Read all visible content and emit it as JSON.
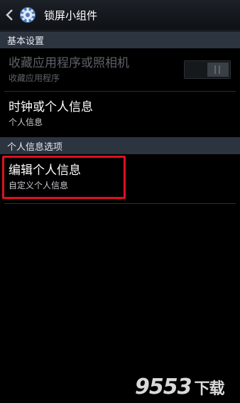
{
  "header": {
    "title": "锁屏小组件"
  },
  "sections": {
    "basic": "基本设置",
    "personal": "个人信息选项"
  },
  "items": {
    "favorite_apps": {
      "title": "收藏应用程序或照相机",
      "subtitle": "收藏应用程序",
      "enabled": false,
      "toggle_on": false
    },
    "clock_info": {
      "title": "时钟或个人信息",
      "subtitle": "个人信息"
    },
    "edit_info": {
      "title": "编辑个人信息",
      "subtitle": "自定义个人信息",
      "highlighted": true
    }
  },
  "watermark": {
    "number": "9553",
    "text": "下载"
  },
  "colors": {
    "highlight": "#e0101e",
    "section_bg": "#2c3440"
  }
}
